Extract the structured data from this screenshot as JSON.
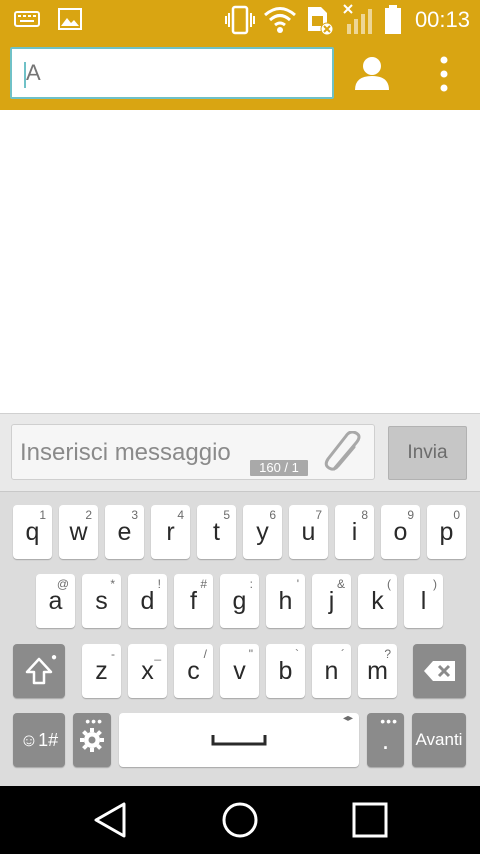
{
  "status_bar": {
    "time": "00:13",
    "icons": [
      "keyboard-icon",
      "image-icon",
      "vibrate-icon",
      "wifi-icon",
      "sim-off-icon",
      "signal-off-icon",
      "battery-icon"
    ]
  },
  "app_bar": {
    "recipient_value": "A",
    "contact_icon": "person-icon",
    "overflow_icon": "more-vertical-icon",
    "color": "#d9a512"
  },
  "composer": {
    "placeholder": "Inserisci messaggio",
    "counter": "160 / 1",
    "attach_icon": "paperclip-icon",
    "send_label": "Invia"
  },
  "keyboard": {
    "row1": [
      {
        "key": "q",
        "hint": "1"
      },
      {
        "key": "w",
        "hint": "2"
      },
      {
        "key": "e",
        "hint": "3"
      },
      {
        "key": "r",
        "hint": "4"
      },
      {
        "key": "t",
        "hint": "5"
      },
      {
        "key": "y",
        "hint": "6"
      },
      {
        "key": "u",
        "hint": "7"
      },
      {
        "key": "i",
        "hint": "8"
      },
      {
        "key": "o",
        "hint": "9"
      },
      {
        "key": "p",
        "hint": "0"
      }
    ],
    "row2": [
      {
        "key": "a",
        "hint": "@"
      },
      {
        "key": "s",
        "hint": "*"
      },
      {
        "key": "d",
        "hint": "!"
      },
      {
        "key": "f",
        "hint": "#"
      },
      {
        "key": "g",
        "hint": ":"
      },
      {
        "key": "h",
        "hint": "'"
      },
      {
        "key": "j",
        "hint": "&"
      },
      {
        "key": "k",
        "hint": "("
      },
      {
        "key": "l",
        "hint": ")"
      }
    ],
    "row3": [
      {
        "key": "z",
        "hint": "-"
      },
      {
        "key": "x",
        "hint": "_"
      },
      {
        "key": "c",
        "hint": "/"
      },
      {
        "key": "v",
        "hint": "\""
      },
      {
        "key": "b",
        "hint": "`"
      },
      {
        "key": "n",
        "hint": "´"
      },
      {
        "key": "m",
        "hint": "?"
      }
    ],
    "symbols_label": "☺1#",
    "period_label": ".",
    "enter_label": "Avanti"
  },
  "nav_bar": {
    "icons": [
      "back-icon",
      "home-icon",
      "recents-icon"
    ]
  }
}
